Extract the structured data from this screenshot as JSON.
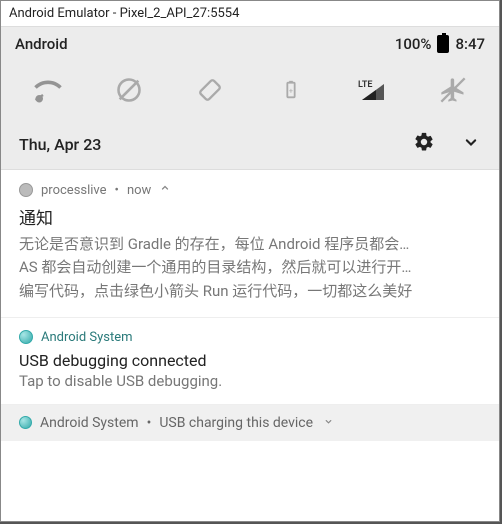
{
  "window_title": "Android Emulator - Pixel_2_API_27:5554",
  "status": {
    "carrier": "Android",
    "battery_pct": "100%",
    "clock": "8:47"
  },
  "date": "Thu, Apr 23",
  "notif1": {
    "app": "processlive",
    "time": "now",
    "title": "通知",
    "line1": "无论是否意识到 Gradle 的存在，每位 Android 程序员都会…",
    "line2": "AS 都会自动创建一个通用的目录结构，然后就可以进行开…",
    "line3": "编写代码，点击绿色小箭头 Run 运行代码，一切都这么美好"
  },
  "notif2": {
    "app": "Android System",
    "title": "USB debugging connected",
    "sub": "Tap to disable USB debugging."
  },
  "notif3": {
    "app": "Android System",
    "summary": "USB charging this device"
  }
}
